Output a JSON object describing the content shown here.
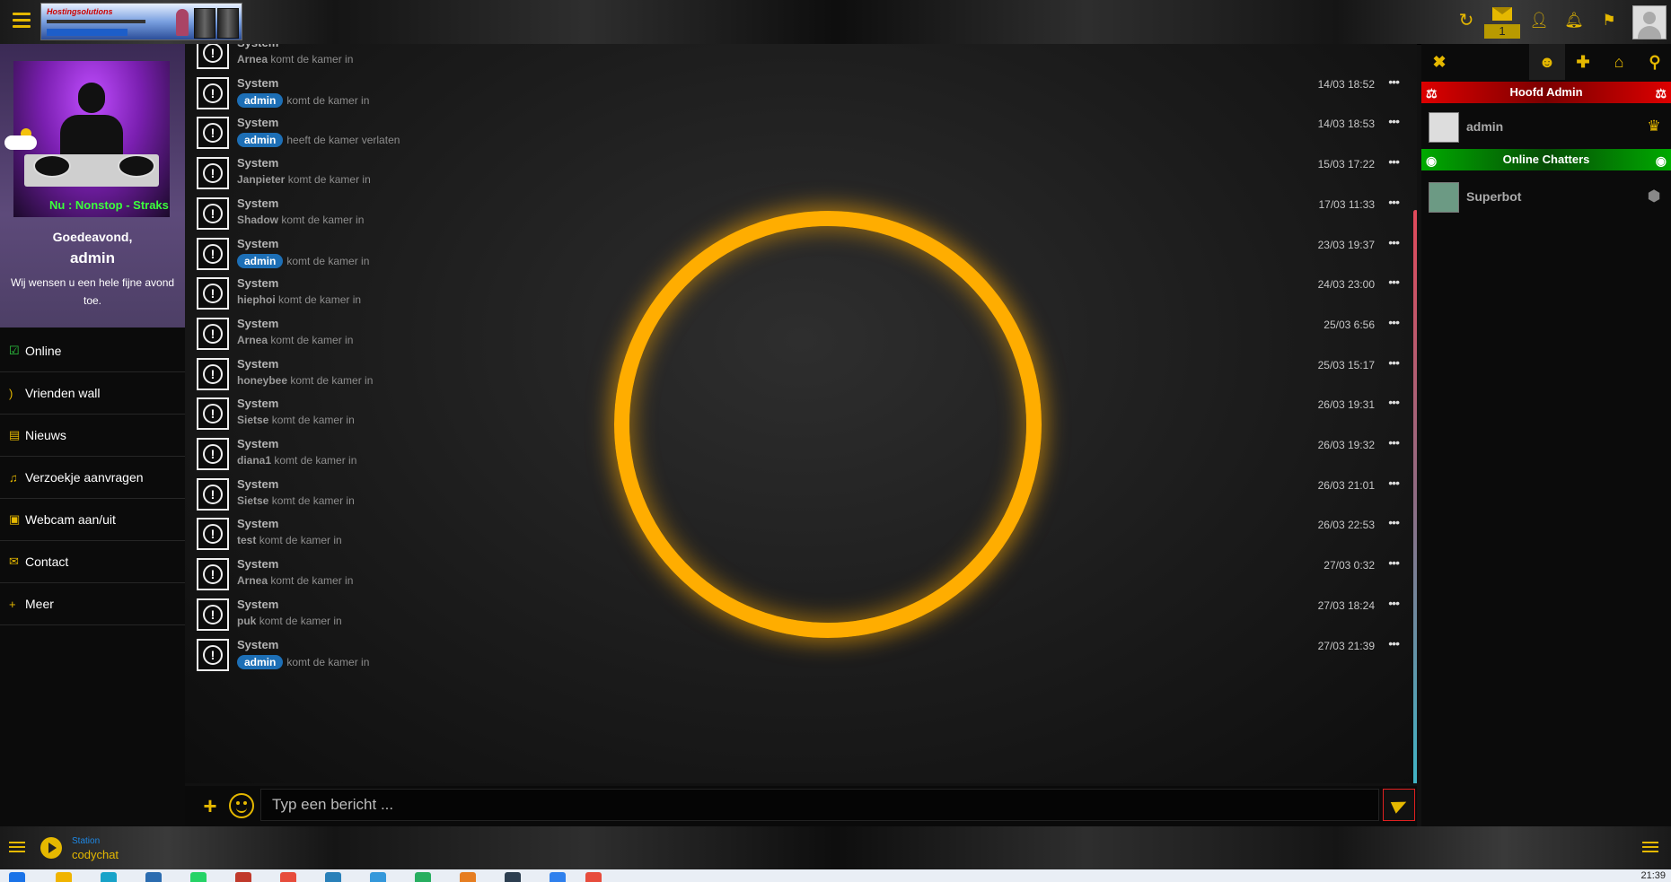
{
  "topbar": {
    "logo_text": "Hostingsolutions",
    "mail_count": "1"
  },
  "profile": {
    "now_playing": "Nu : Nonstop - Straks",
    "greeting": "Goedeavond,",
    "username": "admin",
    "wish": "Wij wensen u een hele fijne avond toe."
  },
  "menu": [
    {
      "label": "Online",
      "icon": "check-square-icon"
    },
    {
      "label": "Vrienden wall",
      "icon": "rss-icon"
    },
    {
      "label": "Nieuws",
      "icon": "newspaper-icon"
    },
    {
      "label": "Verzoekje aanvragen",
      "icon": "music-icon"
    },
    {
      "label": "Webcam aan/uit",
      "icon": "camera-icon"
    },
    {
      "label": "Contact",
      "icon": "envelope-icon"
    },
    {
      "label": "Meer",
      "icon": "plus-icon"
    }
  ],
  "messages": [
    {
      "sender": "System",
      "user": "Arnea",
      "action": "komt de kamer in",
      "badge": false,
      "time": ""
    },
    {
      "sender": "System",
      "user": "admin",
      "action": "komt de kamer in",
      "badge": true,
      "time": "14/03 18:52"
    },
    {
      "sender": "System",
      "user": "admin",
      "action": "heeft de kamer verlaten",
      "badge": true,
      "time": "14/03 18:53"
    },
    {
      "sender": "System",
      "user": "Janpieter",
      "action": "komt de kamer in",
      "badge": false,
      "time": "15/03 17:22"
    },
    {
      "sender": "System",
      "user": "Shadow",
      "action": "komt de kamer in",
      "badge": false,
      "time": "17/03 11:33"
    },
    {
      "sender": "System",
      "user": "admin",
      "action": "komt de kamer in",
      "badge": true,
      "time": "23/03 19:37"
    },
    {
      "sender": "System",
      "user": "hiephoi",
      "action": "komt de kamer in",
      "badge": false,
      "time": "24/03 23:00"
    },
    {
      "sender": "System",
      "user": "Arnea",
      "action": "komt de kamer in",
      "badge": false,
      "time": "25/03 6:56"
    },
    {
      "sender": "System",
      "user": "honeybee",
      "action": "komt de kamer in",
      "badge": false,
      "time": "25/03 15:17"
    },
    {
      "sender": "System",
      "user": "Sietse",
      "action": "komt de kamer in",
      "badge": false,
      "time": "26/03 19:31"
    },
    {
      "sender": "System",
      "user": "diana1",
      "action": "komt de kamer in",
      "badge": false,
      "time": "26/03 19:32"
    },
    {
      "sender": "System",
      "user": "Sietse",
      "action": "komt de kamer in",
      "badge": false,
      "time": "26/03 21:01"
    },
    {
      "sender": "System",
      "user": "test",
      "action": "komt de kamer in",
      "badge": false,
      "time": "26/03 22:53"
    },
    {
      "sender": "System",
      "user": "Arnea",
      "action": "komt de kamer in",
      "badge": false,
      "time": "27/03 0:32"
    },
    {
      "sender": "System",
      "user": "puk",
      "action": "komt de kamer in",
      "badge": false,
      "time": "27/03 18:24"
    },
    {
      "sender": "System",
      "user": "admin",
      "action": "komt de kamer in",
      "badge": true,
      "time": "27/03 21:39"
    }
  ],
  "input": {
    "placeholder": "Typ een bericht ...",
    "value": ""
  },
  "rightpanel": {
    "section_admin": "Hoofd Admin",
    "admin_user": "admin",
    "section_online": "Online Chatters",
    "online_user": "Superbot"
  },
  "bottombar": {
    "station_label": "Station",
    "station_name": "codychat"
  },
  "taskbar": {
    "clock": "21:39"
  },
  "colors": {
    "accent": "#e5b800",
    "badge": "#1d6fb6",
    "admin_header": "#dd0000",
    "online_header": "#00aa00"
  }
}
